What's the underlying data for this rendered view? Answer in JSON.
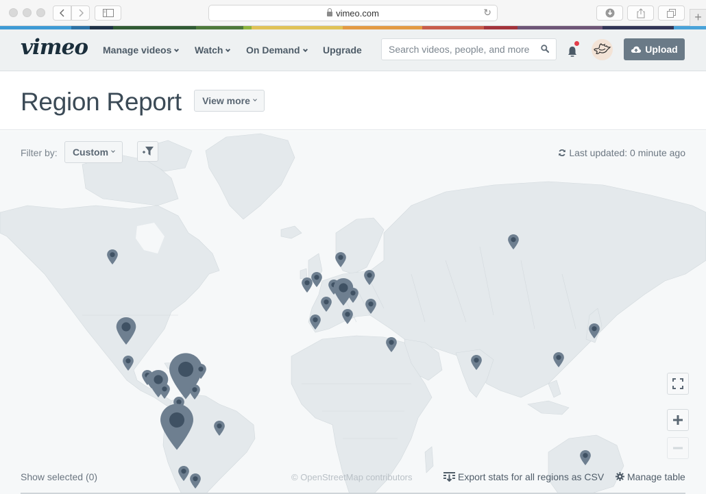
{
  "browser": {
    "url": "vimeo.com",
    "buttons": [
      "back",
      "forward",
      "sidebar",
      "reload",
      "downloads",
      "share",
      "tabs",
      "new-tab"
    ],
    "rainbow_colors": [
      "#3f9bd5",
      "#2d72a6",
      "#1e3146",
      "#315b35",
      "#4e7a3c",
      "#8fb43e",
      "#e0c257",
      "#e39a44",
      "#c85c4b",
      "#a4343c",
      "#6e5677",
      "#323556",
      "#4aa3d9"
    ]
  },
  "header": {
    "logo": "vimeo",
    "nav": [
      {
        "label": "Manage videos",
        "has_dropdown": true
      },
      {
        "label": "Watch",
        "has_dropdown": true
      },
      {
        "label": "On Demand",
        "has_dropdown": true
      },
      {
        "label": "Upgrade",
        "has_dropdown": false
      }
    ],
    "search": {
      "placeholder": "Search videos, people, and more",
      "value": ""
    },
    "notifications": {
      "has_unread": true,
      "dot_color": "#e33d4a"
    },
    "upload_label": "Upload",
    "upload_color": "#6a7a87"
  },
  "page": {
    "title": "Region Report",
    "view_more_label": "View more"
  },
  "map": {
    "filter_label": "Filter by:",
    "filter_value": "Custom",
    "last_updated": "Last updated: 0 minute ago",
    "show_selected": "Show selected (0)",
    "attribution": "© OpenStreetMap contributors",
    "export_label": "Export stats for all regions as CSV",
    "manage_table_label": "Manage table",
    "controls": [
      "fullscreen",
      "zoom-in",
      "zoom-out"
    ],
    "marker_color": "#6e7f90",
    "marker_dot_color": "#3f5163",
    "markers": [
      {
        "region": "Canada",
        "size": "small"
      },
      {
        "region": "United States",
        "size": "medium"
      },
      {
        "region": "Mexico",
        "size": "small"
      },
      {
        "region": "Guatemala",
        "size": "small"
      },
      {
        "region": "El Salvador",
        "size": "small"
      },
      {
        "region": "Honduras",
        "size": "medium"
      },
      {
        "region": "Costa Rica",
        "size": "small"
      },
      {
        "region": "Cuba",
        "size": "large"
      },
      {
        "region": "Dominican Republic",
        "size": "small"
      },
      {
        "region": "Venezuela",
        "size": "small"
      },
      {
        "region": "Colombia",
        "size": "small"
      },
      {
        "region": "Peru",
        "size": "large"
      },
      {
        "region": "Brazil",
        "size": "small"
      },
      {
        "region": "Chile",
        "size": "small"
      },
      {
        "region": "Argentina",
        "size": "small"
      },
      {
        "region": "Ireland",
        "size": "small"
      },
      {
        "region": "United Kingdom",
        "size": "small"
      },
      {
        "region": "Norway",
        "size": "small"
      },
      {
        "region": "Netherlands",
        "size": "small"
      },
      {
        "region": "Germany",
        "size": "medium"
      },
      {
        "region": "Poland",
        "size": "small"
      },
      {
        "region": "Latvia",
        "size": "small"
      },
      {
        "region": "France",
        "size": "small"
      },
      {
        "region": "Spain",
        "size": "small"
      },
      {
        "region": "Italy",
        "size": "small"
      },
      {
        "region": "Romania",
        "size": "small"
      },
      {
        "region": "Israel",
        "size": "small"
      },
      {
        "region": "Russia",
        "size": "small"
      },
      {
        "region": "India",
        "size": "small"
      },
      {
        "region": "China",
        "size": "small"
      },
      {
        "region": "Japan",
        "size": "small"
      },
      {
        "region": "Australia",
        "size": "small"
      }
    ]
  }
}
